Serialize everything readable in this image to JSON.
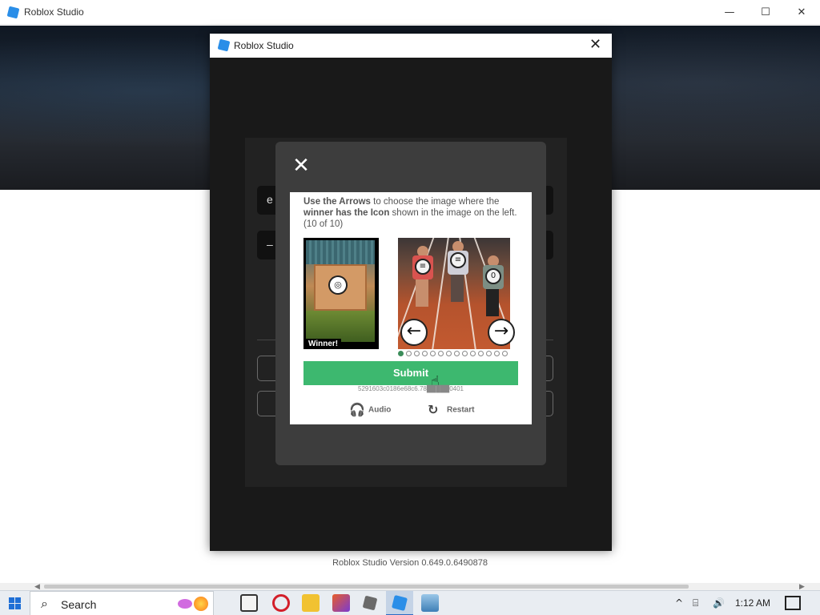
{
  "app": {
    "title": "Roblox Studio",
    "version_text": "Roblox Studio Version 0.649.0.6490878"
  },
  "login_dialog": {
    "title": "Roblox Studio",
    "field_1_char": "e",
    "field_2_char": "–"
  },
  "captcha": {
    "instruction_prefix": "Use the Arrows",
    "instruction_mid": " to choose the image where the ",
    "instruction_bold": "winner has the Icon",
    "instruction_suffix": " shown in the image on the left. (10 of 10)",
    "ref_caption": "Winner!",
    "submit_label": "Submit",
    "session_id": "5291603c0186e68c6.78█████0401",
    "audio_label": "Audio",
    "restart_label": "Restart",
    "page_count": 14,
    "active_page": 1
  },
  "taskbar": {
    "search_label": "Search",
    "clock": "1:12 AM"
  },
  "icons": {
    "close": "close-icon",
    "arrow_left": "arrow-left-icon",
    "arrow_right": "arrow-right-icon",
    "audio": "headphones-icon",
    "restart": "restart-icon"
  },
  "colors": {
    "submit": "#3db86f",
    "accent": "#2a8ee8",
    "active_dot": "#3c8d5a"
  }
}
